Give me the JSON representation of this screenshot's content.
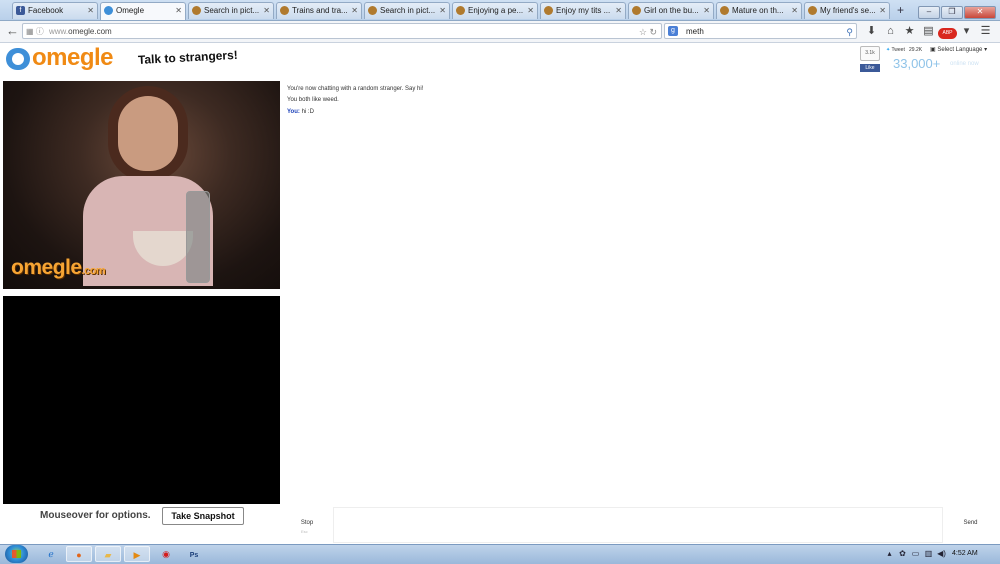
{
  "browser": {
    "tabs": [
      {
        "title": "Facebook",
        "icon": "facebook-icon",
        "color": "#3b5998"
      },
      {
        "title": "Omegle",
        "icon": "omegle-icon",
        "color": "#3e8fd8",
        "active": true
      },
      {
        "title": "Search in pict...",
        "icon": "monkey-icon",
        "color": "#b07a2e"
      },
      {
        "title": "Trains and tra...",
        "icon": "monkey-icon",
        "color": "#b07a2e"
      },
      {
        "title": "Search in pict...",
        "icon": "monkey-icon",
        "color": "#b07a2e"
      },
      {
        "title": "Enjoying a pe...",
        "icon": "monkey-icon",
        "color": "#b07a2e"
      },
      {
        "title": "Enjoy my tits ...",
        "icon": "monkey-icon",
        "color": "#b07a2e"
      },
      {
        "title": "Girl on the bu...",
        "icon": "monkey-icon",
        "color": "#b07a2e"
      },
      {
        "title": "Mature on th...",
        "icon": "monkey-icon",
        "color": "#b07a2e"
      },
      {
        "title": "My friend's se...",
        "icon": "monkey-icon",
        "color": "#b07a2e"
      }
    ],
    "url_prefix": "www.",
    "url_main": "omegle.com",
    "search_value": "meth"
  },
  "header": {
    "logo_text": "omegle",
    "tagline": "Talk to strangers!",
    "plus_count": "3.1k",
    "tweet_label": "Tweet",
    "tweet_count": "29.2K",
    "like_label": "Like",
    "select_language": "Select Language",
    "online_count": "33,000+",
    "online_label": "online now"
  },
  "video": {
    "watermark": "omegle",
    "watermark_suffix": ".com"
  },
  "controls": {
    "mouseover_text": "Mouseover for options.",
    "snapshot_label": "Take Snapshot"
  },
  "chat": {
    "messages": [
      {
        "type": "status",
        "text": "You're now chatting with a random stranger. Say hi!"
      },
      {
        "type": "status",
        "text": "You both like weed."
      },
      {
        "type": "you",
        "speaker": "You:",
        "text": "hi :D"
      }
    ],
    "stop_label": "Stop",
    "stop_hint": "Esc",
    "send_label": "Send"
  },
  "taskbar": {
    "clock": "4:52 AM"
  },
  "colors": {
    "accent": "#f08a14",
    "logo_blue": "#3e8fd8",
    "you_label": "#1a3fb8"
  }
}
